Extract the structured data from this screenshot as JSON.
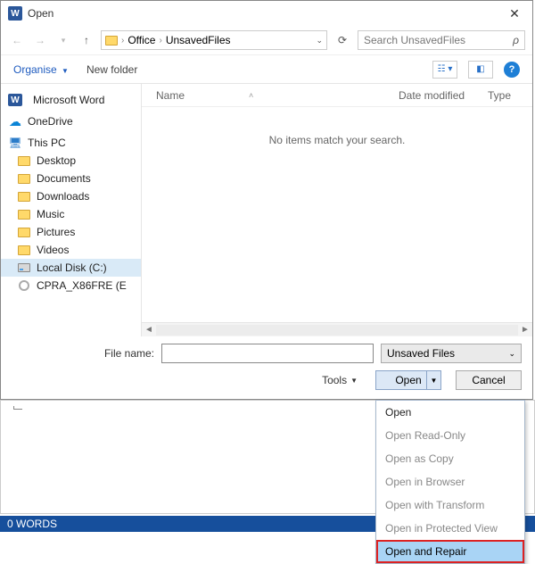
{
  "title": "Open",
  "breadcrumb": {
    "seg1": "Office",
    "seg2": "UnsavedFiles"
  },
  "search_placeholder": "Search UnsavedFiles",
  "toolbar": {
    "organise": "Organise",
    "new_folder": "New folder"
  },
  "tree": {
    "word": "Microsoft Word",
    "onedrive": "OneDrive",
    "thispc": "This PC",
    "desktop": "Desktop",
    "documents": "Documents",
    "downloads": "Downloads",
    "music": "Music",
    "pictures": "Pictures",
    "videos": "Videos",
    "localdisk": "Local Disk (C:)",
    "cpra": "CPRA_X86FRE (E"
  },
  "columns": {
    "name": "Name",
    "date": "Date modified",
    "type": "Type"
  },
  "empty_message": "No items match your search.",
  "footer": {
    "filename_label": "File name:",
    "filter": "Unsaved Files",
    "tools": "Tools",
    "open": "Open",
    "cancel": "Cancel"
  },
  "menu": {
    "open": "Open",
    "readonly": "Open Read-Only",
    "copy": "Open as Copy",
    "browser": "Open in Browser",
    "transform": "Open with Transform",
    "protected": "Open in Protected View",
    "repair": "Open and Repair"
  },
  "status": {
    "words": "0 WORDS"
  }
}
